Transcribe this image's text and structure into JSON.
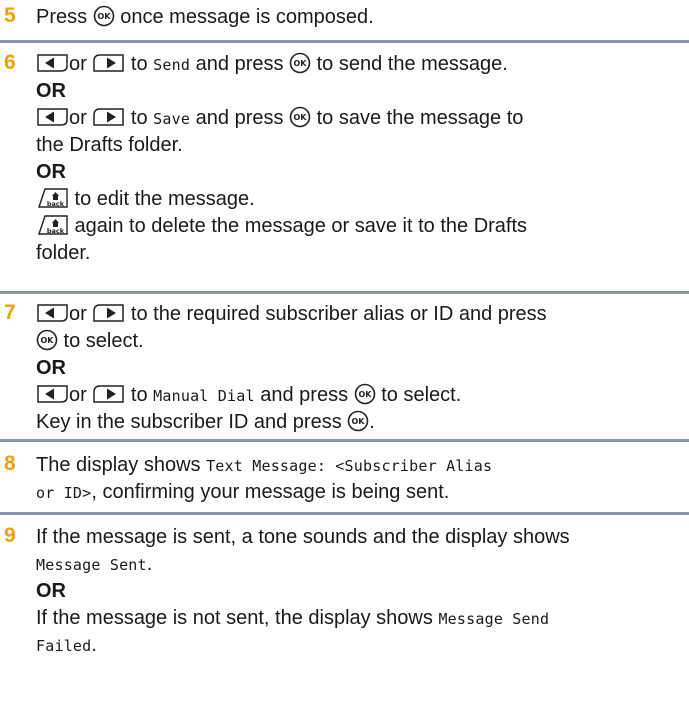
{
  "steps": [
    {
      "number": "5",
      "lines": [
        {
          "before": "Press ",
          "after": " once message is composed."
        }
      ]
    },
    {
      "number": "6",
      "line1": {
        "or": "or",
        "to": " to ",
        "code": "Send",
        "mid": " and press ",
        "after": " to send the message."
      },
      "or1": "OR",
      "line2": {
        "or": "or",
        "to": " to ",
        "code": "Save",
        "mid": " and press ",
        "after": " to save the message to"
      },
      "line3": "the Drafts folder.",
      "or2": "OR",
      "line4": " to edit the message.",
      "line5": " again to delete the message or save it to the Drafts",
      "line6": "folder."
    },
    {
      "number": "7",
      "line1": {
        "or": "or",
        "after": " to the required subscriber alias or ID and press"
      },
      "line2": " to select.",
      "or1": "OR",
      "line3": {
        "or": "or",
        "to": " to ",
        "code": "Manual Dial",
        "mid": " and press ",
        "after": " to select."
      },
      "line4": {
        "before": "Key in the subscriber ID and press ",
        "after": "."
      }
    },
    {
      "number": "8",
      "line1": {
        "before": "The display shows ",
        "code": "Text Message: <Subscriber Alias"
      },
      "line2": {
        "code": "or ID>",
        "after": ", confirming your message is being sent."
      }
    },
    {
      "number": "9",
      "line1": "If the message is sent, a tone sounds and the display shows",
      "line2": {
        "code": "Message Sent",
        "after": "."
      },
      "or1": "OR",
      "line3": {
        "before": "If the message is not sent, the display shows ",
        "code": "Message Send"
      },
      "line4": {
        "code": "Failed",
        "after": "."
      }
    }
  ],
  "icons": {
    "ok": "ok-button-icon",
    "left": "left-arrow-key-icon",
    "right": "right-arrow-key-icon",
    "back": "back-home-key-icon",
    "ok_label": "OK",
    "back_label": "back"
  },
  "colors": {
    "step_number": "#f5a000",
    "separator": "#8a96a7"
  }
}
